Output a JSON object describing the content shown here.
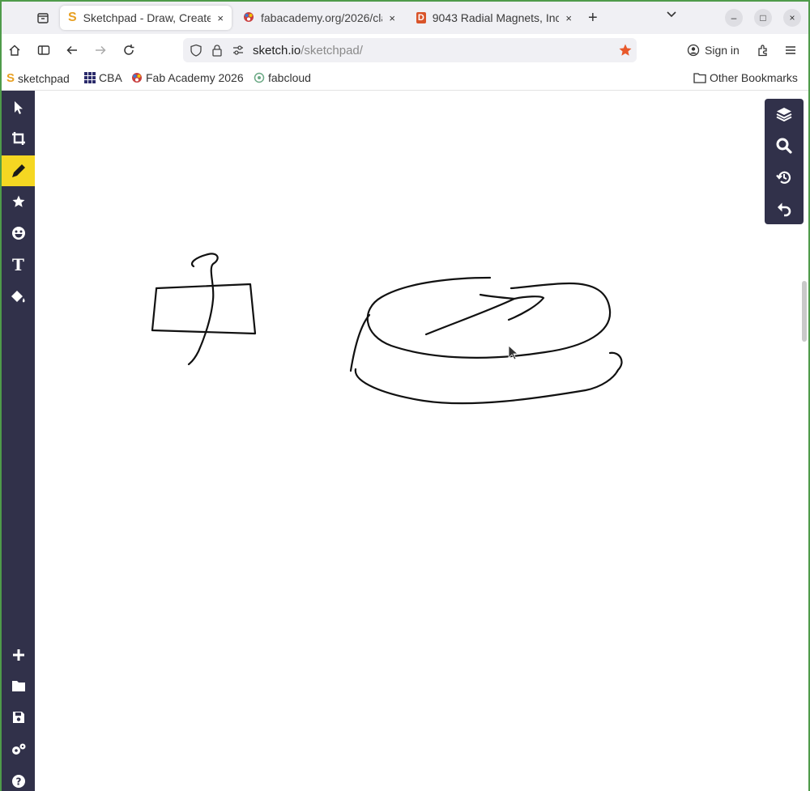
{
  "tabs": [
    {
      "title": "Sketchpad - Draw, Create",
      "active": true
    },
    {
      "title": "fabacademy.org/2026/cla",
      "active": false
    },
    {
      "title": "9043 Radial Magnets, Inc",
      "active": false
    }
  ],
  "tab_close_glyph": "×",
  "new_tab_glyph": "+",
  "window_controls": {
    "minimize": "–",
    "maximize": "□",
    "close": "×"
  },
  "url": {
    "domain": "sketch.io",
    "path": "/sketchpad/"
  },
  "sign_in_label": "Sign in",
  "bookmarks": [
    {
      "label": "sketchpad",
      "icon": "sketchpad-logo-icon"
    },
    {
      "label": "CBA",
      "icon": "grid-icon"
    },
    {
      "label": "Fab Academy 2026",
      "icon": "fab-academy-icon"
    },
    {
      "label": "fabcloud",
      "icon": "fabcloud-icon"
    }
  ],
  "other_bookmarks_label": "Other Bookmarks",
  "left_tools": [
    "select-icon",
    "crop-icon",
    "pencil-icon",
    "star-icon",
    "emoji-icon",
    "text-icon",
    "fill-icon"
  ],
  "left_tools_bottom": [
    "add-icon",
    "folder-icon",
    "save-icon",
    "settings-icon",
    "help-icon"
  ],
  "active_tool": "pencil-icon",
  "right_tools": [
    "layers-icon",
    "zoom-icon",
    "history-icon",
    "undo-icon"
  ],
  "colors": {
    "toolbar_bg": "#31314a",
    "active_tool_bg": "#f5d722",
    "bookmark_star": "#e8582a",
    "window_border": "#4f9b4a"
  }
}
